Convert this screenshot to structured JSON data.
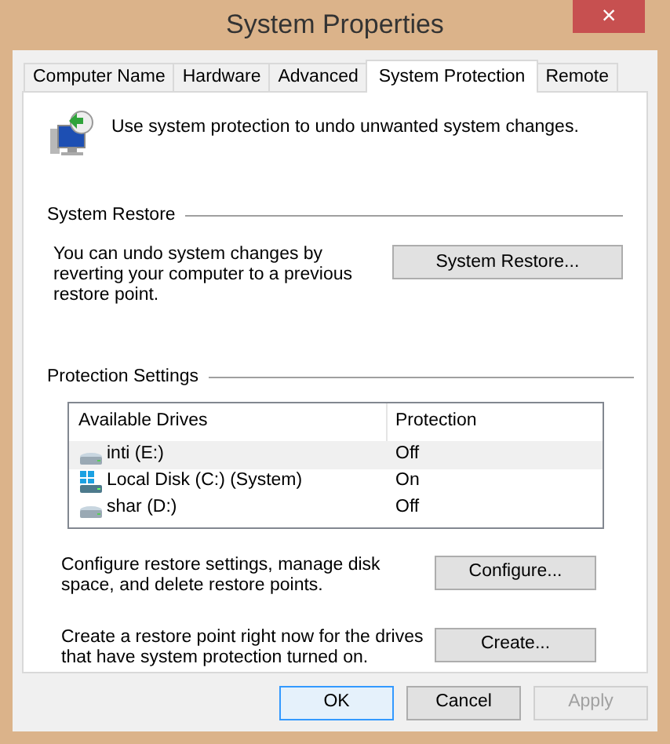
{
  "window": {
    "title": "System Properties",
    "close": "×"
  },
  "tabs": [
    {
      "label": "Computer Name",
      "selected": false
    },
    {
      "label": "Hardware",
      "selected": false
    },
    {
      "label": "Advanced",
      "selected": false
    },
    {
      "label": "System Protection",
      "selected": true
    },
    {
      "label": "Remote",
      "selected": false
    }
  ],
  "intro": "Use system protection to undo unwanted system changes.",
  "system_restore": {
    "heading": "System Restore",
    "text": "You can undo system changes by reverting your computer to a previous restore point.",
    "button": "System Restore..."
  },
  "protection_settings": {
    "heading": "Protection Settings",
    "columns": [
      "Available Drives",
      "Protection"
    ],
    "rows": [
      {
        "drive": "inti (E:)",
        "protection": "Off",
        "kind": "drive",
        "selected": true
      },
      {
        "drive": "Local Disk (C:) (System)",
        "protection": "On",
        "kind": "system",
        "selected": false
      },
      {
        "drive": "shar (D:)",
        "protection": "Off",
        "kind": "drive",
        "selected": false
      }
    ],
    "actions": [
      {
        "text": "Configure restore settings, manage disk space, and delete restore points.",
        "button": "Configure..."
      },
      {
        "text": "Create a restore point right now for the drives that have system protection turned on.",
        "button": "Create..."
      }
    ]
  },
  "buttons": [
    {
      "label": "OK",
      "default": true,
      "disabled": false
    },
    {
      "label": "Cancel",
      "default": false,
      "disabled": false
    },
    {
      "label": "Apply",
      "default": false,
      "disabled": true
    }
  ]
}
